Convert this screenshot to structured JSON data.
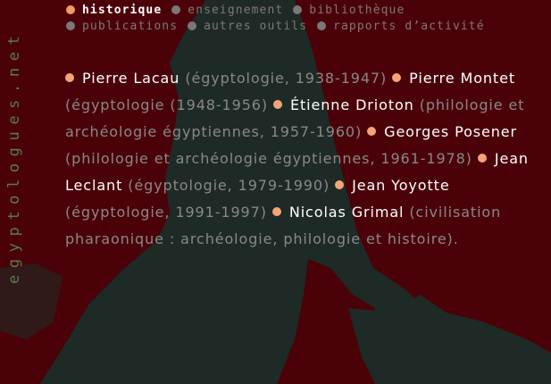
{
  "site": {
    "vertical_title": "egyptologues.net"
  },
  "nav": {
    "row1": [
      {
        "label": "historique",
        "active": true
      },
      {
        "label": "enseignement",
        "active": false
      },
      {
        "label": "bibliothèque",
        "active": false
      }
    ],
    "row2": [
      {
        "label": "publications",
        "active": false
      },
      {
        "label": "autres outils",
        "active": false
      },
      {
        "label": "rapports d’activité",
        "active": false
      }
    ]
  },
  "professors": [
    {
      "name": "Pierre Lacau",
      "detail": "(égyptologie, 1938-1947)"
    },
    {
      "name": "Pierre Montet",
      "detail": "(égyptologie (1948-1956)"
    },
    {
      "name": "Étienne Drioton",
      "detail": "(philologie et archéologie égyptiennes, 1957-1960)"
    },
    {
      "name": "Georges Posener",
      "detail": "(philologie et archéologie égyptiennes, 1961-1978)"
    },
    {
      "name": "Jean Leclant",
      "detail": "(égyptologie, 1979-1990)"
    },
    {
      "name": "Jean Yoyotte",
      "detail": "(égyptologie, 1991-1997)"
    },
    {
      "name": "Nicolas Grimal",
      "detail": "(civilisation pharaonique : archéologie, philologie et histoire)."
    }
  ],
  "colors": {
    "background": "#4a0208",
    "silhouette": "#1e2a25",
    "accent_dot": "#f4a477",
    "nav_inactive": "#7e7878",
    "site_title": "#5a7a4e"
  },
  "icons": {
    "bullet": "bullet-dot-icon"
  }
}
